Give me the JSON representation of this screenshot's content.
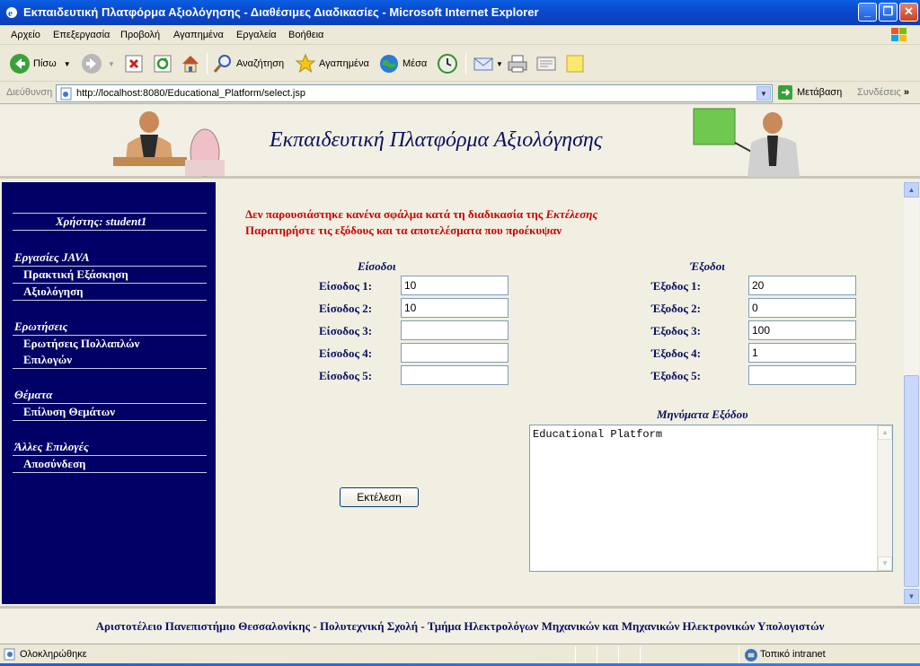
{
  "window": {
    "title": "Εκπαιδευτική Πλατφόρμα Αξιολόγησης - Διαθέσιμες Διαδικασίες - Microsoft Internet Explorer"
  },
  "menu": [
    "Αρχείο",
    "Επεξεργασία",
    "Προβολή",
    "Αγαπημένα",
    "Εργαλεία",
    "Βοήθεια"
  ],
  "toolbar": {
    "back": "Πίσω",
    "search": "Αναζήτηση",
    "favorites": "Αγαπημένα",
    "media": "Μέσα"
  },
  "address": {
    "label": "Διεύθυνση",
    "url": "http://localhost:8080/Educational_Platform/select.jsp",
    "go": "Μετάβαση",
    "links": "Συνδέσεις"
  },
  "header": {
    "title": "Εκπαιδευτική Πλατφόρμα Αξιολόγησης"
  },
  "sidebar": {
    "user": "Χρήστης: student1",
    "sections": [
      {
        "heading": "Εργασίες JAVA",
        "links": [
          "Πρακτική Εξάσκηση",
          "Αξιολόγηση"
        ]
      },
      {
        "heading": "Ερωτήσεις",
        "links": [
          "Ερωτήσεις Πολλαπλών",
          "Επιλογών"
        ]
      },
      {
        "heading": "Θέματα",
        "links": [
          "Επίλυση Θεμάτων"
        ]
      },
      {
        "heading": "Άλλες Επιλογές",
        "links": [
          "Αποσύνδεση"
        ]
      }
    ]
  },
  "content": {
    "message_line1": "Δεν παρουσιάστηκε κανένα σφάλμα κατά τη διαδικασία της ",
    "message_line1_em": "Εκτέλεσης",
    "message_line2": "Παρατηρήστε τις εξόδους και τα αποτελέσματα που προέκυψαν",
    "inputs_heading": "Είσοδοι",
    "outputs_heading": "Έξοδοι",
    "inputs": [
      {
        "label": "Είσοδος 1:",
        "value": "10"
      },
      {
        "label": "Είσοδος 2:",
        "value": "10"
      },
      {
        "label": "Είσοδος 3:",
        "value": ""
      },
      {
        "label": "Είσοδος 4:",
        "value": ""
      },
      {
        "label": "Είσοδος 5:",
        "value": ""
      }
    ],
    "outputs": [
      {
        "label": "Έξοδος 1:",
        "value": "20"
      },
      {
        "label": "Έξοδος 2:",
        "value": "0"
      },
      {
        "label": "Έξοδος 3:",
        "value": "100"
      },
      {
        "label": "Έξοδος 4:",
        "value": "1"
      },
      {
        "label": "Έξοδος 5:",
        "value": ""
      }
    ],
    "messages_heading": "Μηνύματα Εξόδου",
    "messages_text": "Educational Platform",
    "run_button": "Εκτέλεση"
  },
  "footer": {
    "text": "Αριστοτέλειο Πανεπιστήμιο Θεσσαλονίκης - Πολυτεχνική Σχολή - Τμήμα Ηλεκτρολόγων Μηχανικών και Μηχανικών Ηλεκτρονικών Υπολογιστών"
  },
  "status": {
    "left": "Ολοκληρώθηκε",
    "zone": "Τοπικό intranet"
  }
}
